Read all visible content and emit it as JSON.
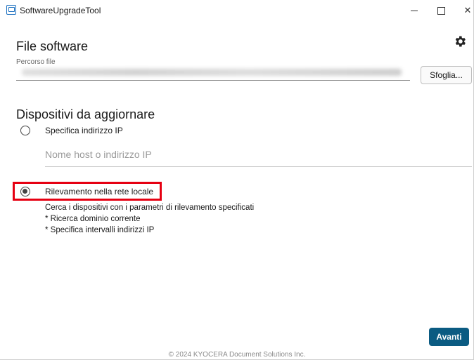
{
  "window": {
    "title": "SoftwareUpgradeTool"
  },
  "file_section": {
    "heading": "File software",
    "path_label": "Percorso file",
    "browse_label": "Sfoglia..."
  },
  "devices_section": {
    "heading": "Dispositivi da aggiornare",
    "option_ip_label": "Specifica indirizzo IP",
    "host_placeholder": "Nome host o indirizzo IP",
    "option_local_label": "Rilevamento nella rete locale",
    "selected_option": "Rilevamento nella rete locale",
    "local_desc": [
      "Cerca i dispositivi con i parametri di rilevamento specificati",
      "* Ricerca dominio corrente",
      "* Specifica intervalli indirizzi IP"
    ]
  },
  "actions": {
    "next_label": "Avanti"
  },
  "footer": {
    "copyright": "© 2024 KYOCERA Document Solutions Inc."
  },
  "colors": {
    "accent": "#0b5b82",
    "highlight": "#e60012"
  }
}
